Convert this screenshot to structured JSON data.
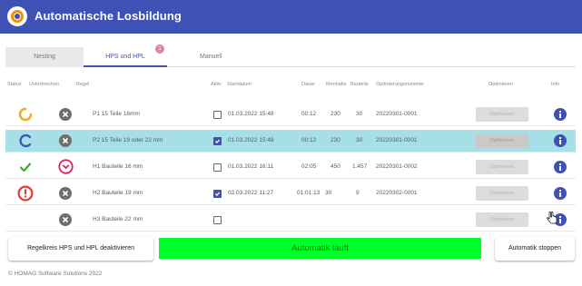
{
  "app": {
    "title": "Automatische Losbildung",
    "colors": {
      "header": "#3f51b5",
      "accent": "#3f51b5",
      "logo": "#f39200",
      "status_running": "#00ff28",
      "selected_row": "#a7dfe6",
      "ok_green": "#3aaa35",
      "error_red": "#e53935",
      "warn_orange": "#f5a623",
      "info_blue": "#3f51b5"
    }
  },
  "tabs": [
    {
      "label": "Nesting"
    },
    {
      "label": "HPS und HPL",
      "badge": "1"
    },
    {
      "label": "Manuell"
    }
  ],
  "columns": [
    "Status",
    "Unterbrechen",
    "Regel",
    "Aktiv",
    "Startdatum",
    "Dauer",
    "Menhalte",
    "Bauteile",
    "Optimierungsnummer",
    "Optimieren",
    "Info"
  ],
  "rows": [
    {
      "status_icon": "spinner-orange-icon",
      "interrupt_icon": "close-circle-icon",
      "rule": "P1 15 Teile 16mm",
      "active": false,
      "start": "01.03.2022 15:48",
      "duration": "00:12",
      "count1": "230",
      "count2": "30",
      "opt_number": "20220301-0001",
      "optimize_label": "Optimieren",
      "info_icon": "info-icon"
    },
    {
      "status_icon": "spinner-blue-icon",
      "interrupt_icon": "close-circle-icon",
      "rule": "P2 15 Teile 19 oder 22 mm",
      "active": true,
      "start": "01.03.2022 15:48",
      "duration": "00:12",
      "count1": "230",
      "count2": "30",
      "opt_number": "20220301-0001",
      "optimize_label": "Optimieren",
      "info_icon": "info-icon"
    },
    {
      "status_icon": "checkmark-icon",
      "interrupt_icon": "chevron-down-circle-icon",
      "rule": "H1 Bauteile 16 mm",
      "active": false,
      "start": "01.03.2022 16:11",
      "duration": "02:05",
      "count1": "450",
      "count2": "1.457",
      "opt_number": "20220301-0002",
      "optimize_label": "Optimieren",
      "info_icon": "info-icon"
    },
    {
      "status_icon": "error-icon",
      "interrupt_icon": "close-circle-icon",
      "rule": "H2 Bauteile 19 mm",
      "active": true,
      "start": "02.03.2022 11:27",
      "duration": "01:01:13",
      "count1": "30",
      "count2": "9",
      "opt_number": "20220302-0001",
      "optimize_label": "Optimieren",
      "info_icon": "info-icon"
    },
    {
      "status_icon": "",
      "interrupt_icon": "close-circle-icon",
      "rule": "H3 Bauteile 22 mm",
      "active": false,
      "start": "",
      "duration": "",
      "count1": "",
      "count2": "",
      "opt_number": "",
      "optimize_label": "Optimieren",
      "info_icon": "info-icon"
    }
  ],
  "actions": {
    "deactivate": "Regelkreis HPS und HPL deaktivieren",
    "status": "Automatik läuft",
    "stop": "Automatik stoppen"
  },
  "footer": "© HOMAG Software Solutions 2022"
}
